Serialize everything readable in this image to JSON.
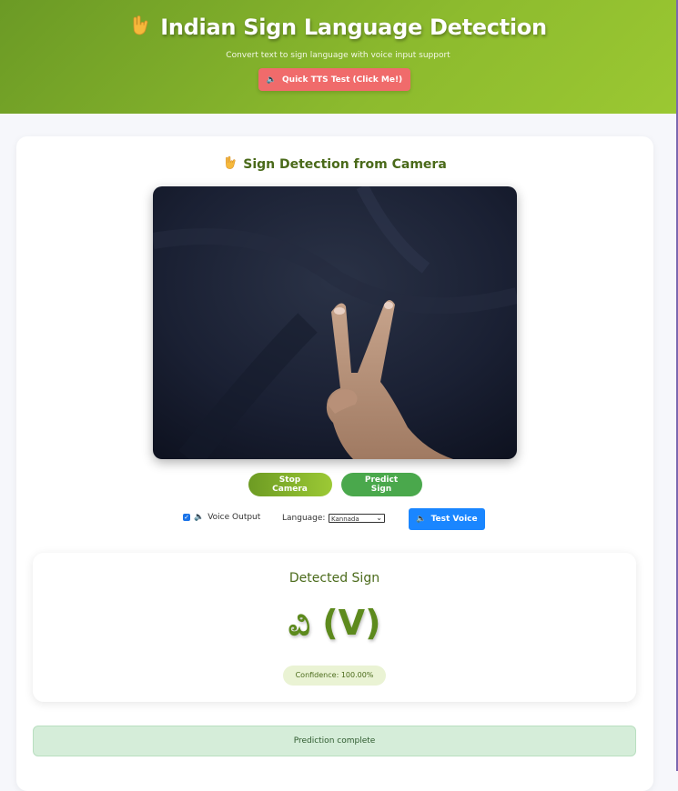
{
  "header": {
    "title": "Indian Sign Language Detection",
    "subtitle": "Convert text to sign language with voice input support",
    "tts_button": "Quick TTS Test (Click Me!)"
  },
  "camera_section": {
    "title": "Sign Detection from Camera",
    "stop_button": "Stop Camera",
    "predict_button": "Predict Sign",
    "voice_output_label": "Voice Output",
    "voice_output_checked": true,
    "language_label": "Language:",
    "language_value": "Kannada",
    "test_voice_button": "Test Voice"
  },
  "result": {
    "title": "Detected Sign",
    "sign": "ವಿ (V)",
    "confidence": "Confidence: 100.00%"
  },
  "status": {
    "message": "Prediction complete"
  },
  "icons": {
    "hand": "love-you-hand-icon",
    "speaker": "speaker-icon"
  },
  "colors": {
    "header_green": "#8dbb2e",
    "accent_text": "#4a6a1a",
    "tts_red": "#f06b6b",
    "test_voice_blue": "#1a86ff",
    "status_bg": "#d5edd9"
  }
}
